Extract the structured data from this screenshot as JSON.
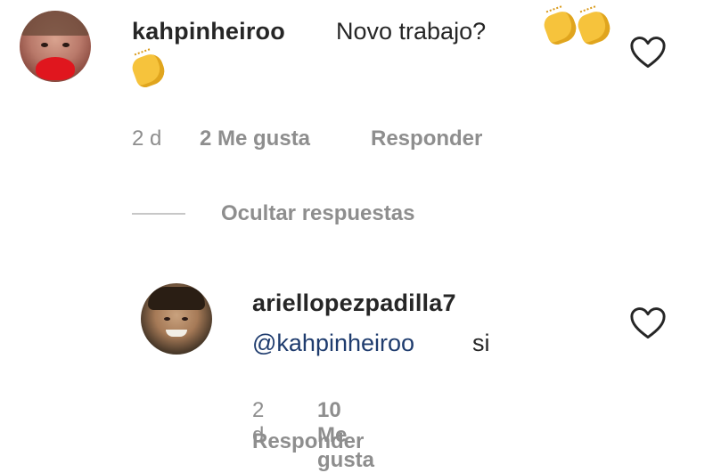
{
  "comment": {
    "username": "kahpinheiroo",
    "text": "Novo trabajo?",
    "emojis": [
      "clapping-hands",
      "clapping-hands",
      "clapping-hands"
    ],
    "time": "2 d",
    "likes": "2 Me gusta",
    "reply_label": "Responder"
  },
  "replies_toggle": {
    "label": "Ocultar respuestas"
  },
  "reply": {
    "username": "ariellopezpadilla7",
    "mention": "@kahpinheiroo",
    "text": "si",
    "time": "2 d",
    "likes": "10 Me gusta",
    "reply_label": "Responder"
  },
  "colors": {
    "text": "#262626",
    "meta": "#8e8e8e",
    "mention": "#1f3c6e",
    "emoji": "#f6c33c"
  }
}
